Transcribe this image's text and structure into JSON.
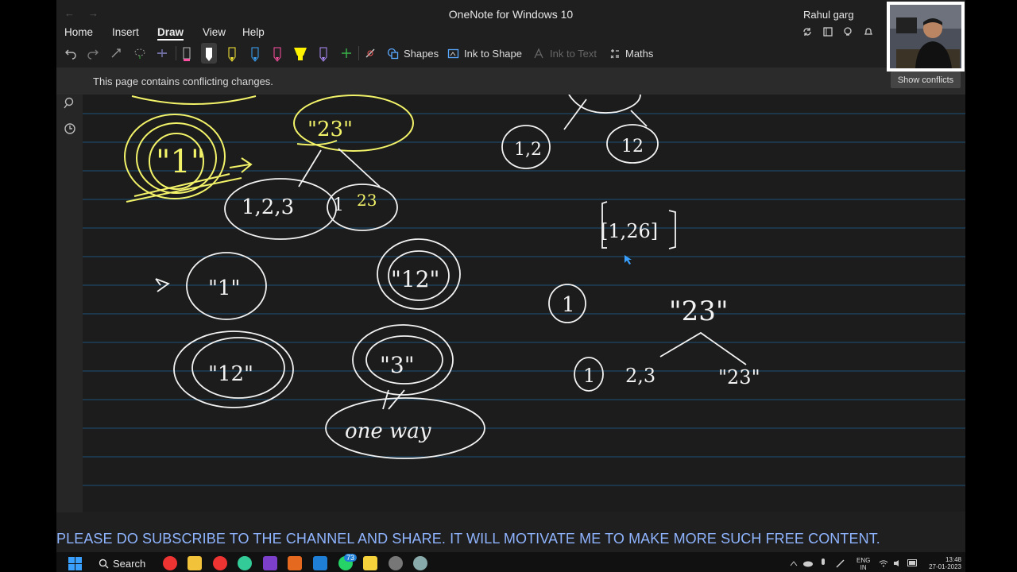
{
  "window": {
    "title": "OneNote for Windows 10",
    "user": "Rahul garg"
  },
  "menu": {
    "items": [
      "Home",
      "Insert",
      "Draw",
      "View",
      "Help"
    ],
    "active": "Draw"
  },
  "ribbon": {
    "shapes": "Shapes",
    "ink_to_shape": "Ink to Shape",
    "ink_to_text": "Ink to Text",
    "maths": "Maths"
  },
  "colors": {
    "pen_black": "#222222",
    "pen_white": "#ffffff",
    "pen_yellow": "#ffee33",
    "pen_blue": "#3da5ff",
    "pen_pink": "#ff4fa3",
    "highlighter_yellow": "#fff200",
    "pen_lavender": "#b08cff",
    "ink_white": "#f2f2f2",
    "ink_yellow": "#f3f36a",
    "rule_line": "#1c3e5a"
  },
  "notice": {
    "text": "This page contains conflicting changes.",
    "button": "Show conflicts"
  },
  "canvas": {
    "ink_text": [
      "\"23\"",
      "\"1\"",
      "1,2,3",
      "1",
      "23",
      "\"1\"",
      "\"12\"",
      "\"12\"",
      "\"3\"",
      "one way",
      "1,2",
      "12",
      "[1,26]",
      "1",
      "\"23\"",
      "1",
      "2,3",
      "\"23\""
    ]
  },
  "banner": "PLEASE DO SUBSCRIBE TO THE CHANNEL AND SHARE. IT WILL MOTIVATE ME TO MAKE MORE SUCH FREE CONTENT.",
  "taskbar": {
    "search": "Search",
    "badge": "73",
    "lang_line1": "ENG",
    "lang_line2": "IN",
    "time": "13:48",
    "date": "27-01-2023"
  }
}
